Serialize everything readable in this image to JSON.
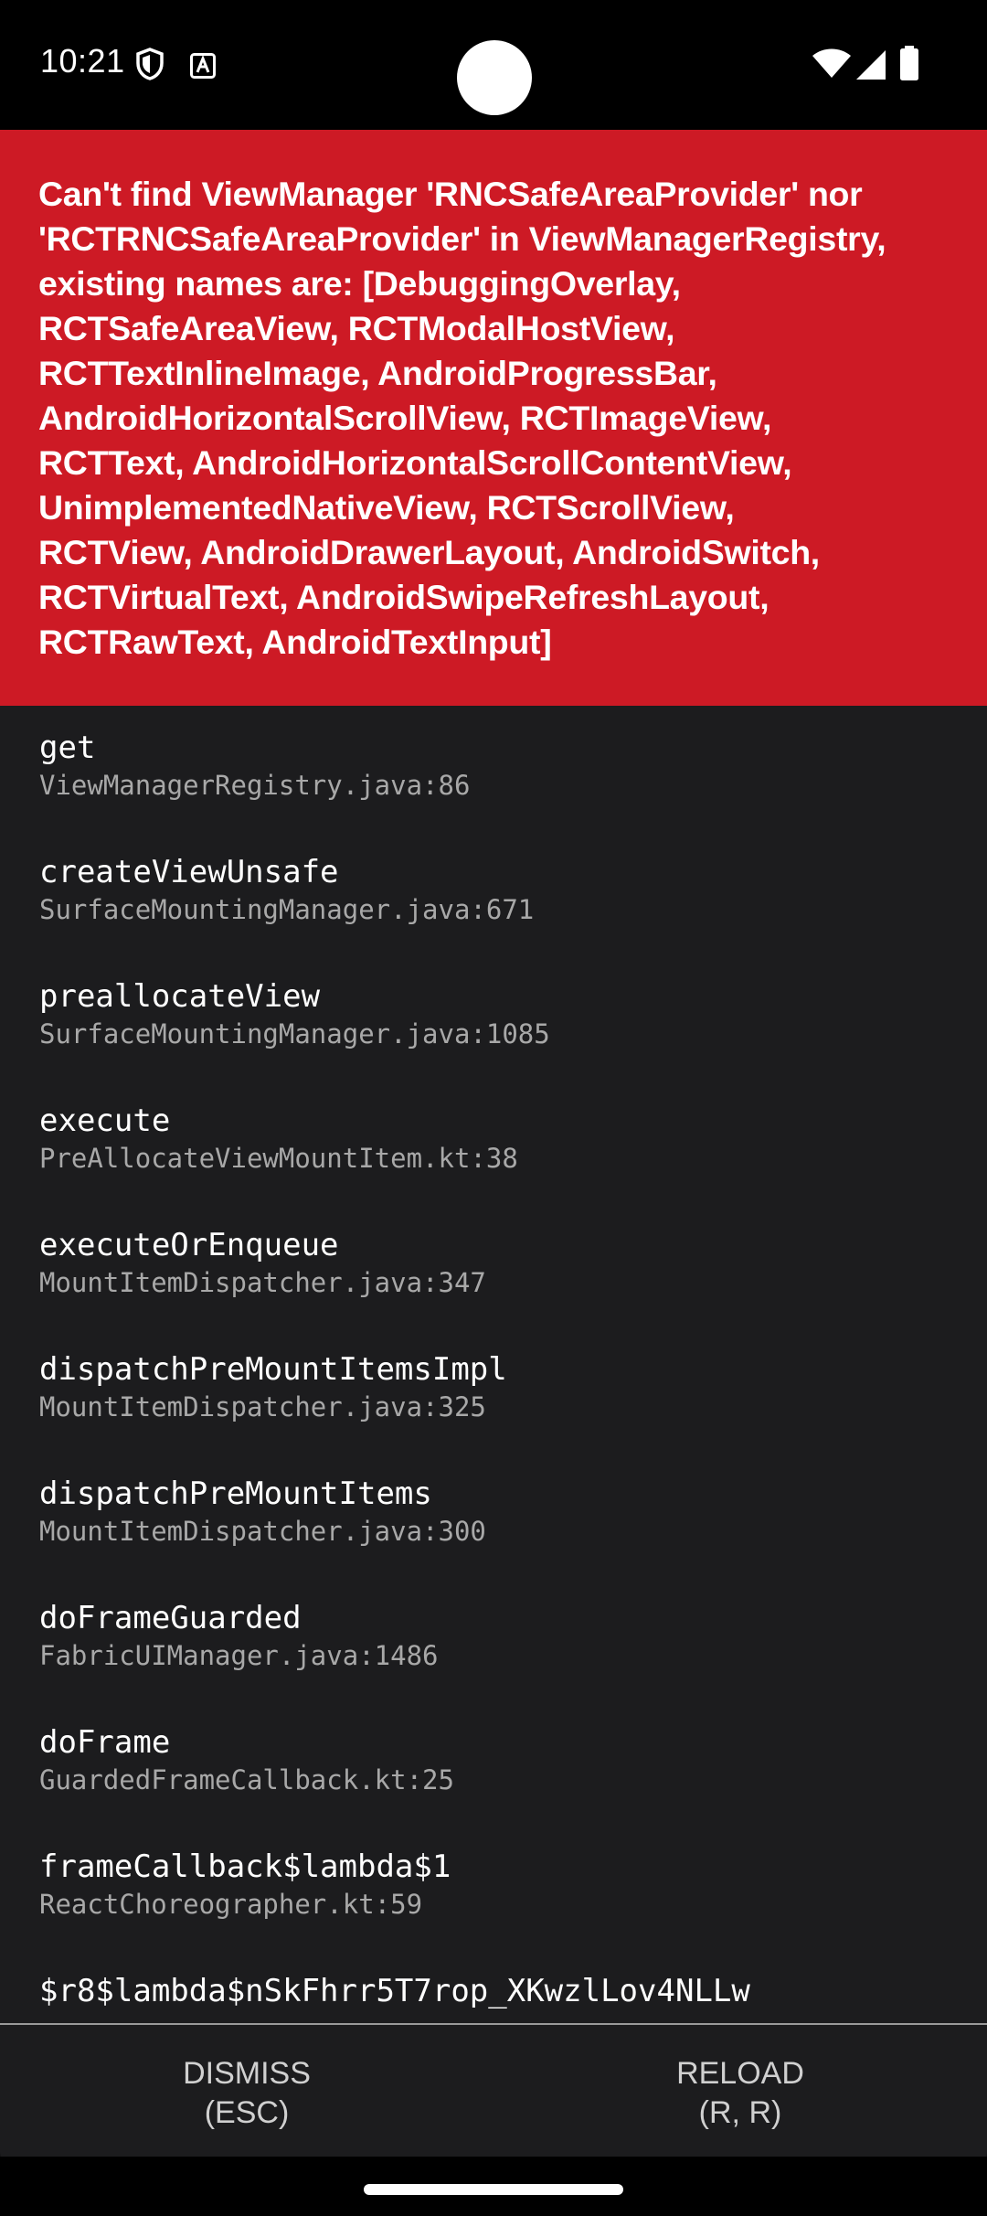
{
  "status_bar": {
    "time": "10:21",
    "left_icons": [
      "shield-icon",
      "font-a-icon"
    ],
    "right_icons": [
      "wifi-icon",
      "signal-icon",
      "battery-icon"
    ]
  },
  "error": {
    "message": "Can't find ViewManager 'RNCSafeAreaProvider' nor\n'RCTRNCSafeAreaProvider' in ViewManagerRegistry,\nexisting names are: [DebuggingOverlay,\nRCTSafeAreaView, RCTModalHostView,\nRCTTextInlineImage, AndroidProgressBar,\nAndroidHorizontalScrollView, RCTImageView,\nRCTText, AndroidHorizontalScrollContentView,\nUnimplementedNativeView, RCTScrollView,\nRCTView, AndroidDrawerLayout, AndroidSwitch,\nRCTVirtualText, AndroidSwipeRefreshLayout,\nRCTRawText, AndroidTextInput]",
    "background_color": "#cd1a25"
  },
  "stack": [
    {
      "method": "get",
      "file": "ViewManagerRegistry.java:86"
    },
    {
      "method": "createViewUnsafe",
      "file": "SurfaceMountingManager.java:671"
    },
    {
      "method": "preallocateView",
      "file": "SurfaceMountingManager.java:1085"
    },
    {
      "method": "execute",
      "file": "PreAllocateViewMountItem.kt:38"
    },
    {
      "method": "executeOrEnqueue",
      "file": "MountItemDispatcher.java:347"
    },
    {
      "method": "dispatchPreMountItemsImpl",
      "file": "MountItemDispatcher.java:325"
    },
    {
      "method": "dispatchPreMountItems",
      "file": "MountItemDispatcher.java:300"
    },
    {
      "method": "doFrameGuarded",
      "file": "FabricUIManager.java:1486"
    },
    {
      "method": "doFrame",
      "file": "GuardedFrameCallback.kt:25"
    },
    {
      "method": "frameCallback$lambda$1",
      "file": "ReactChoreographer.kt:59"
    },
    {
      "method": "$r8$lambda$nSkFhrr5T7rop_XKwzlLov4NLLw",
      "file": ""
    }
  ],
  "footer": {
    "dismiss_label": "DISMISS",
    "dismiss_shortcut": "(ESC)",
    "reload_label": "RELOAD",
    "reload_shortcut": "(R, R)"
  }
}
